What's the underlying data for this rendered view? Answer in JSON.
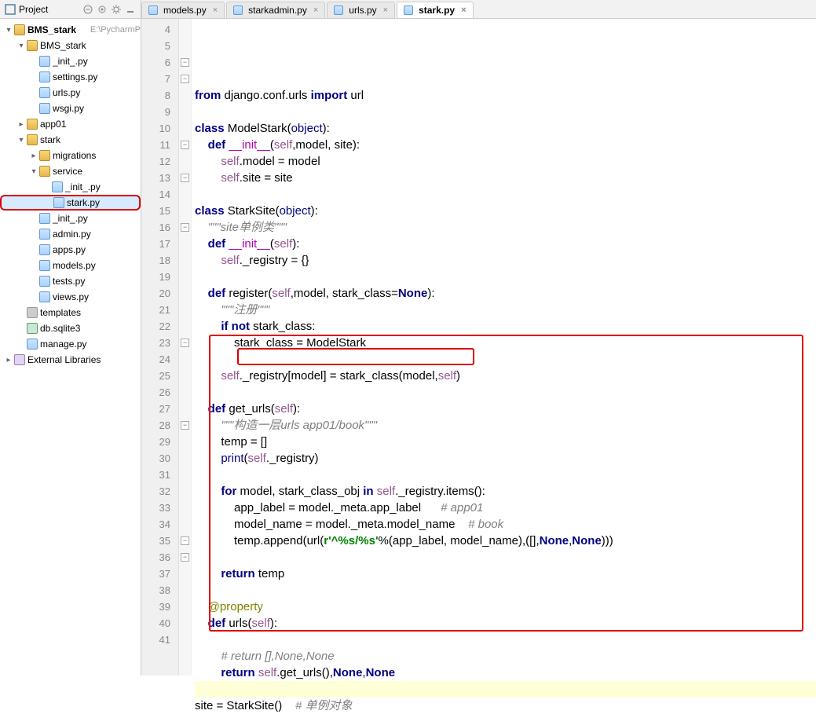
{
  "header": {
    "title": "Project"
  },
  "tabs": [
    {
      "label": "models.py",
      "active": false
    },
    {
      "label": "starkadmin.py",
      "active": false
    },
    {
      "label": "urls.py",
      "active": false
    },
    {
      "label": "stark.py",
      "active": true
    }
  ],
  "project_root": {
    "name": "BMS_stark",
    "path": "E:\\PycharmP"
  },
  "tree": [
    {
      "level": 0,
      "exp": "▾",
      "icon": "folder-open",
      "name": "BMS_stark",
      "path": "E:\\PycharmP",
      "sel": false,
      "bold": true
    },
    {
      "level": 1,
      "exp": "▾",
      "icon": "folder-open",
      "name": "BMS_stark"
    },
    {
      "level": 2,
      "exp": "",
      "icon": "pyfile",
      "name": "_init_.py"
    },
    {
      "level": 2,
      "exp": "",
      "icon": "pyfile",
      "name": "settings.py"
    },
    {
      "level": 2,
      "exp": "",
      "icon": "pyfile",
      "name": "urls.py"
    },
    {
      "level": 2,
      "exp": "",
      "icon": "pyfile",
      "name": "wsgi.py"
    },
    {
      "level": 1,
      "exp": "▸",
      "icon": "folder-open",
      "name": "app01"
    },
    {
      "level": 1,
      "exp": "▾",
      "icon": "folder-open",
      "name": "stark"
    },
    {
      "level": 2,
      "exp": "▸",
      "icon": "folder-open",
      "name": "migrations"
    },
    {
      "level": 2,
      "exp": "▾",
      "icon": "folder-open",
      "name": "service"
    },
    {
      "level": 3,
      "exp": "",
      "icon": "pyfile",
      "name": "_init_.py"
    },
    {
      "level": 3,
      "exp": "",
      "icon": "pyfile",
      "name": "stark.py",
      "sel": true,
      "circ": true
    },
    {
      "level": 2,
      "exp": "",
      "icon": "pyfile",
      "name": "_init_.py"
    },
    {
      "level": 2,
      "exp": "",
      "icon": "pyfile",
      "name": "admin.py"
    },
    {
      "level": 2,
      "exp": "",
      "icon": "pyfile",
      "name": "apps.py"
    },
    {
      "level": 2,
      "exp": "",
      "icon": "pyfile",
      "name": "models.py"
    },
    {
      "level": 2,
      "exp": "",
      "icon": "pyfile",
      "name": "tests.py"
    },
    {
      "level": 2,
      "exp": "",
      "icon": "pyfile",
      "name": "views.py"
    },
    {
      "level": 1,
      "exp": "",
      "icon": "folder-gray",
      "name": "templates"
    },
    {
      "level": 1,
      "exp": "",
      "icon": "dbfile",
      "name": "db.sqlite3"
    },
    {
      "level": 1,
      "exp": "",
      "icon": "pyfile",
      "name": "manage.py"
    },
    {
      "level": 0,
      "exp": "▸",
      "icon": "lib",
      "name": "External Libraries"
    }
  ],
  "editor": {
    "first_line": 4,
    "cursor_line": 40,
    "fold_marks": [
      6,
      7,
      11,
      13,
      16,
      23,
      28,
      35,
      36
    ],
    "lines": [
      [
        [
          "kw",
          "from"
        ],
        [
          "",
          " django.conf.urls "
        ],
        [
          "kw",
          "import"
        ],
        [
          "",
          " url"
        ]
      ],
      [
        [
          "",
          ""
        ]
      ],
      [
        [
          "kw",
          "class"
        ],
        [
          "",
          " ModelStark("
        ],
        [
          "bi",
          "object"
        ],
        [
          "",
          ""
        ],
        [
          "",
          "):"
        ]
      ],
      [
        [
          "",
          "    "
        ],
        [
          "kw",
          "def"
        ],
        [
          "",
          " "
        ],
        [
          "mag",
          "__init__"
        ],
        [
          "",
          "("
        ],
        [
          "self",
          "self"
        ],
        [
          "",
          ",model, site):"
        ]
      ],
      [
        [
          "",
          "        "
        ],
        [
          "self",
          "self"
        ],
        [
          "",
          ".model = model"
        ]
      ],
      [
        [
          "",
          "        "
        ],
        [
          "self",
          "self"
        ],
        [
          "",
          ".site = site"
        ]
      ],
      [
        [
          "",
          ""
        ]
      ],
      [
        [
          "kw",
          "class"
        ],
        [
          "",
          " StarkSite("
        ],
        [
          "bi",
          "object"
        ],
        [
          "",
          "):"
        ]
      ],
      [
        [
          "",
          "    "
        ],
        [
          "doc",
          "\"\"\"site单例类\"\"\""
        ]
      ],
      [
        [
          "",
          "    "
        ],
        [
          "kw",
          "def"
        ],
        [
          "",
          " "
        ],
        [
          "mag",
          "__init__"
        ],
        [
          "",
          "("
        ],
        [
          "self",
          "self"
        ],
        [
          "",
          "):"
        ]
      ],
      [
        [
          "",
          "        "
        ],
        [
          "self",
          "self"
        ],
        [
          "",
          "._registry = {}"
        ]
      ],
      [
        [
          "",
          ""
        ]
      ],
      [
        [
          "",
          "    "
        ],
        [
          "kw",
          "def "
        ],
        [
          "",
          "register("
        ],
        [
          "self",
          "self"
        ],
        [
          "",
          ",model, stark_class="
        ],
        [
          "kw",
          "None"
        ],
        [
          "",
          "):"
        ]
      ],
      [
        [
          "",
          "        "
        ],
        [
          "doc",
          "\"\"\"注册\"\"\""
        ]
      ],
      [
        [
          "",
          "        "
        ],
        [
          "kw",
          "if not"
        ],
        [
          "",
          " stark_class:"
        ]
      ],
      [
        [
          "",
          "            stark_class = ModelStark"
        ]
      ],
      [
        [
          "",
          ""
        ]
      ],
      [
        [
          "",
          "        "
        ],
        [
          "self",
          "self"
        ],
        [
          "",
          "._registry[model] = stark_class(model,"
        ],
        [
          "self",
          "self"
        ],
        [
          "",
          ")"
        ]
      ],
      [
        [
          "",
          ""
        ]
      ],
      [
        [
          "",
          "    "
        ],
        [
          "kw",
          "def "
        ],
        [
          "",
          "get_urls("
        ],
        [
          "self",
          "self"
        ],
        [
          "",
          "):"
        ]
      ],
      [
        [
          "",
          "        "
        ],
        [
          "doc",
          "\"\"\"构造一层urls app01/book\"\"\""
        ]
      ],
      [
        [
          "",
          "        temp = []"
        ]
      ],
      [
        [
          "",
          "        "
        ],
        [
          "bi",
          "print"
        ],
        [
          "",
          "("
        ],
        [
          "self",
          "self"
        ],
        [
          "",
          "._registry)"
        ]
      ],
      [
        [
          "",
          ""
        ]
      ],
      [
        [
          "",
          "        "
        ],
        [
          "kw",
          "for"
        ],
        [
          "",
          " model, stark_class_obj "
        ],
        [
          "kw",
          "in"
        ],
        [
          "",
          " "
        ],
        [
          "self",
          "self"
        ],
        [
          "",
          "._registry.items():"
        ]
      ],
      [
        [
          "",
          "            app_label = model._meta.app_label      "
        ],
        [
          "cmt",
          "# app01"
        ]
      ],
      [
        [
          "",
          "            model_name = model._meta.model_name    "
        ],
        [
          "cmt",
          "# book"
        ]
      ],
      [
        [
          "",
          "            temp.append(url("
        ],
        [
          "str",
          "r'^%s/%s'"
        ],
        [
          "",
          "%(app_label, model_name),([],"
        ],
        [
          "kw",
          "None"
        ],
        [
          "",
          ","
        ],
        [
          "kw",
          "None"
        ],
        [
          "",
          ")))"
        ]
      ],
      [
        [
          "",
          ""
        ]
      ],
      [
        [
          "",
          "        "
        ],
        [
          "kw",
          "return"
        ],
        [
          "",
          " temp"
        ]
      ],
      [
        [
          "",
          ""
        ]
      ],
      [
        [
          "",
          "    "
        ],
        [
          "dec",
          "@property"
        ]
      ],
      [
        [
          "",
          "    "
        ],
        [
          "kw",
          "def "
        ],
        [
          "",
          "urls("
        ],
        [
          "self",
          "self"
        ],
        [
          "",
          "):"
        ]
      ],
      [
        [
          "",
          ""
        ]
      ],
      [
        [
          "",
          "        "
        ],
        [
          "cmt",
          "# return [],None,None"
        ]
      ],
      [
        [
          "",
          "        "
        ],
        [
          "kw",
          "return"
        ],
        [
          "",
          " "
        ],
        [
          "self",
          "self"
        ],
        [
          "",
          ".get_urls(),"
        ],
        [
          "kw",
          "None"
        ],
        [
          "",
          ","
        ],
        [
          "kw",
          "None"
        ]
      ],
      [
        [
          "",
          ""
        ]
      ],
      [
        [
          "",
          "site = StarkSite()    "
        ],
        [
          "cmt",
          "# 单例对象"
        ]
      ]
    ]
  }
}
